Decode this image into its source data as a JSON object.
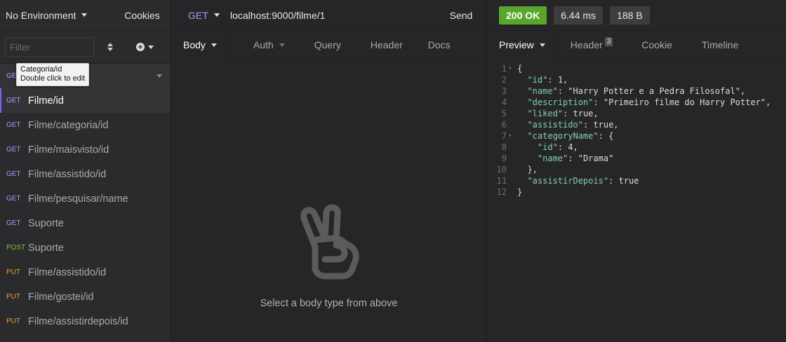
{
  "sidebar": {
    "environment": "No Environment",
    "cookies": "Cookies",
    "filter_placeholder": "Filter",
    "tooltip": {
      "line1": "Categoria/id",
      "line2": "Double click to edit"
    },
    "folder_method_partial": "GE",
    "requests": [
      {
        "method": "GET",
        "name": "Filme/id",
        "method_class": "m-get"
      },
      {
        "method": "GET",
        "name": "Filme/categoria/id",
        "method_class": "m-get"
      },
      {
        "method": "GET",
        "name": "Filme/maisvisto/id",
        "method_class": "m-get"
      },
      {
        "method": "GET",
        "name": "Filme/assistido/id",
        "method_class": "m-get"
      },
      {
        "method": "GET",
        "name": "Filme/pesquisar/name",
        "method_class": "m-get"
      },
      {
        "method": "GET",
        "name": "Suporte",
        "method_class": "m-get"
      },
      {
        "method": "POST",
        "name": "Suporte",
        "method_class": "m-post"
      },
      {
        "method": "PUT",
        "name": "Filme/assistido/id",
        "method_class": "m-put"
      },
      {
        "method": "PUT",
        "name": "Filme/gostei/id",
        "method_class": "m-put"
      },
      {
        "method": "PUT",
        "name": "Filme/assistirdepois/id",
        "method_class": "m-put"
      }
    ]
  },
  "request": {
    "method": "GET",
    "url": "localhost:9000/filme/1",
    "send_label": "Send",
    "tabs": [
      "Body",
      "Auth",
      "Query",
      "Header",
      "Docs"
    ],
    "empty_message": "Select a body type from above"
  },
  "response": {
    "status": "200 OK",
    "time": "6.44 ms",
    "size": "188 B",
    "tabs": [
      "Preview",
      "Header",
      "Cookie",
      "Timeline"
    ],
    "header_count": "3",
    "body_lines": [
      "{",
      "  \"id\": 1,",
      "  \"name\": \"Harry Potter e a Pedra Filosofal\",",
      "  \"description\": \"Primeiro filme do Harry Potter\",",
      "  \"liked\": true,",
      "  \"assistido\": true,",
      "  \"categoryName\": {",
      "    \"id\": 4,",
      "    \"name\": \"Drama\"",
      "  },",
      "  \"assistirDepois\": true",
      "}"
    ]
  },
  "colors": {
    "accent": "#7b61ff",
    "get": "#a997ff",
    "post": "#7cc243",
    "put": "#ef9f2f",
    "status_ok": "#5aa52b",
    "json_key": "#7fd1a8",
    "json_string": "#f2e25c"
  }
}
